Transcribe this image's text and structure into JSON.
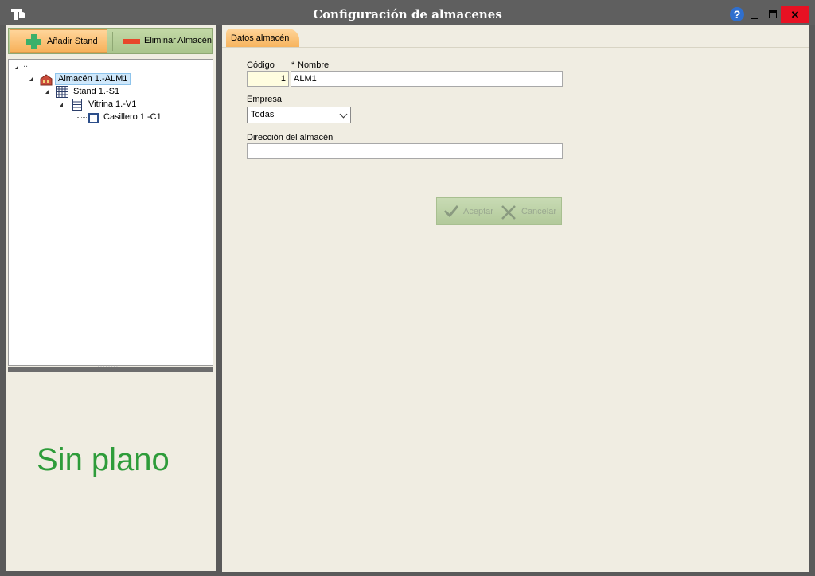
{
  "window": {
    "title": "Configuración de almacenes",
    "help_label": "?",
    "close_label": "✕"
  },
  "toolbar": {
    "add_label": "Añadir Stand",
    "delete_label": "Eliminar Almacén"
  },
  "tree": {
    "root_label": "..",
    "nodes": [
      {
        "label": "Almacén 1.-ALM1",
        "icon": "warehouse-icon",
        "selected": true
      },
      {
        "label": "Stand 1.-S1",
        "icon": "grid-icon"
      },
      {
        "label": "Vitrina 1.-V1",
        "icon": "shelf-icon"
      },
      {
        "label": "Casillero 1.-C1",
        "icon": "square-icon"
      }
    ]
  },
  "plan": {
    "message": "Sin plano",
    "color": "#2e9c3a"
  },
  "form": {
    "tab_label": "Datos almacén",
    "code_label": "Código",
    "code_value": "1",
    "name_required_mark": "*",
    "name_label": "Nombre",
    "name_value": "ALM1",
    "company_label": "Empresa",
    "company_value": "Todas",
    "address_label": "Dirección del almacén",
    "address_value": "",
    "accept_label": "Aceptar",
    "cancel_label": "Cancelar"
  },
  "colors": {
    "titlebar": "#5f5f5f",
    "accent_orange": "#f7b15a",
    "accent_green": "#a9c48c",
    "close_red": "#e81123"
  }
}
